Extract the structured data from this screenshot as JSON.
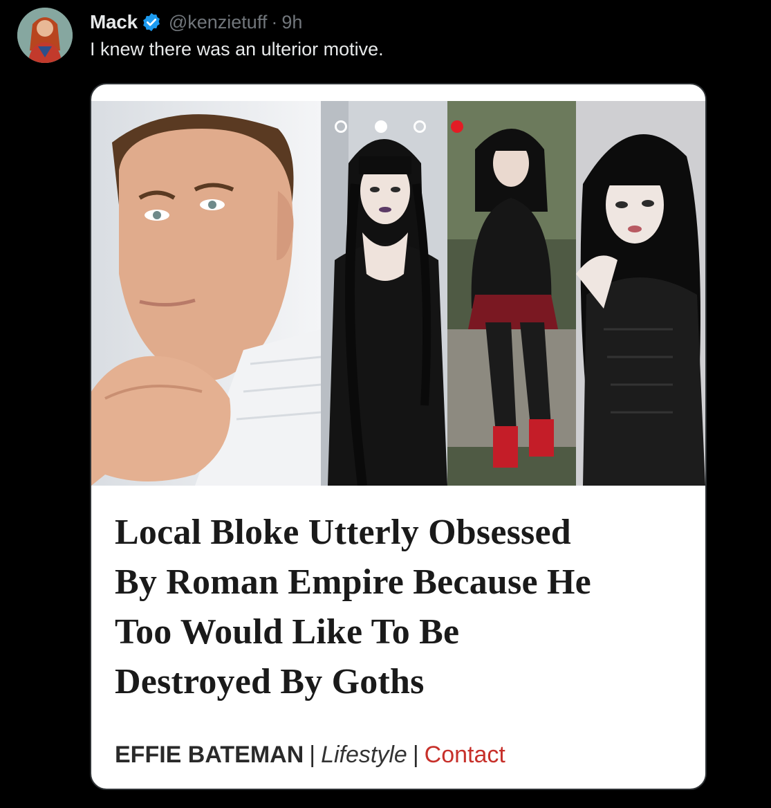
{
  "tweet": {
    "author": {
      "display_name": "Mack",
      "handle": "@kenzietuff",
      "verified_icon": "verified-badge-icon",
      "avatar_icon": "avatar-image"
    },
    "separator": "·",
    "time": "9h",
    "text": "I knew there was an ulterior motive."
  },
  "media": {
    "photos": [
      {
        "name": "man-portrait"
      },
      {
        "name": "goth-woman-1"
      },
      {
        "name": "goth-woman-2"
      },
      {
        "name": "goth-woman-3"
      }
    ],
    "carousel_dots": 4,
    "active_dot": 4,
    "accent_color": "#e31c25",
    "headline_lines": [
      "Local Bloke Utterly Obsessed",
      "By Roman Empire Because He",
      "Too Would Like To Be",
      "Destroyed By Goths"
    ],
    "byline": {
      "author": "EFFIE BATEMAN",
      "separator": "|",
      "section": "Lifestyle",
      "contact": "Contact",
      "contact_color": "#c7302a"
    }
  },
  "colors": {
    "background": "#000000",
    "primary_text": "#e7e9ea",
    "secondary_text": "#71767b",
    "verified_blue": "#1d9bf0"
  }
}
